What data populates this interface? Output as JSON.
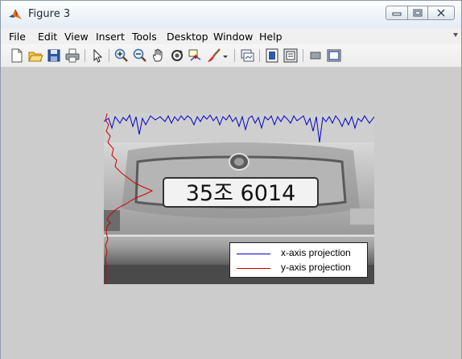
{
  "window": {
    "title": "Figure 3"
  },
  "menu": [
    "File",
    "Edit",
    "View",
    "Insert",
    "Tools",
    "Desktop",
    "Window",
    "Help"
  ],
  "toolbar": [
    {
      "name": "new-figure-icon"
    },
    {
      "name": "open-file-icon"
    },
    {
      "name": "save-icon"
    },
    {
      "name": "print-icon"
    },
    {
      "name": "pointer-icon"
    },
    {
      "name": "zoom-in-icon"
    },
    {
      "name": "zoom-out-icon"
    },
    {
      "name": "pan-hand-icon"
    },
    {
      "name": "rotate-3d-icon"
    },
    {
      "name": "data-cursor-icon"
    },
    {
      "name": "brush-icon"
    },
    {
      "name": "brush-dropdown-icon"
    },
    {
      "name": "link-plot-icon"
    },
    {
      "name": "colorbar-icon"
    },
    {
      "name": "legend-icon"
    },
    {
      "name": "hide-plot-tools-icon"
    },
    {
      "name": "show-plot-tools-icon"
    }
  ],
  "plate": {
    "text": "35조 6014"
  },
  "legend": [
    {
      "label": "x-axis projection",
      "color": "#0000cc"
    },
    {
      "label": "y-axis projection",
      "color": "#cc0000"
    }
  ],
  "colors": {
    "x_projection": "#0000cc",
    "y_projection": "#cc0000",
    "figure_bg": "#cccccc"
  }
}
